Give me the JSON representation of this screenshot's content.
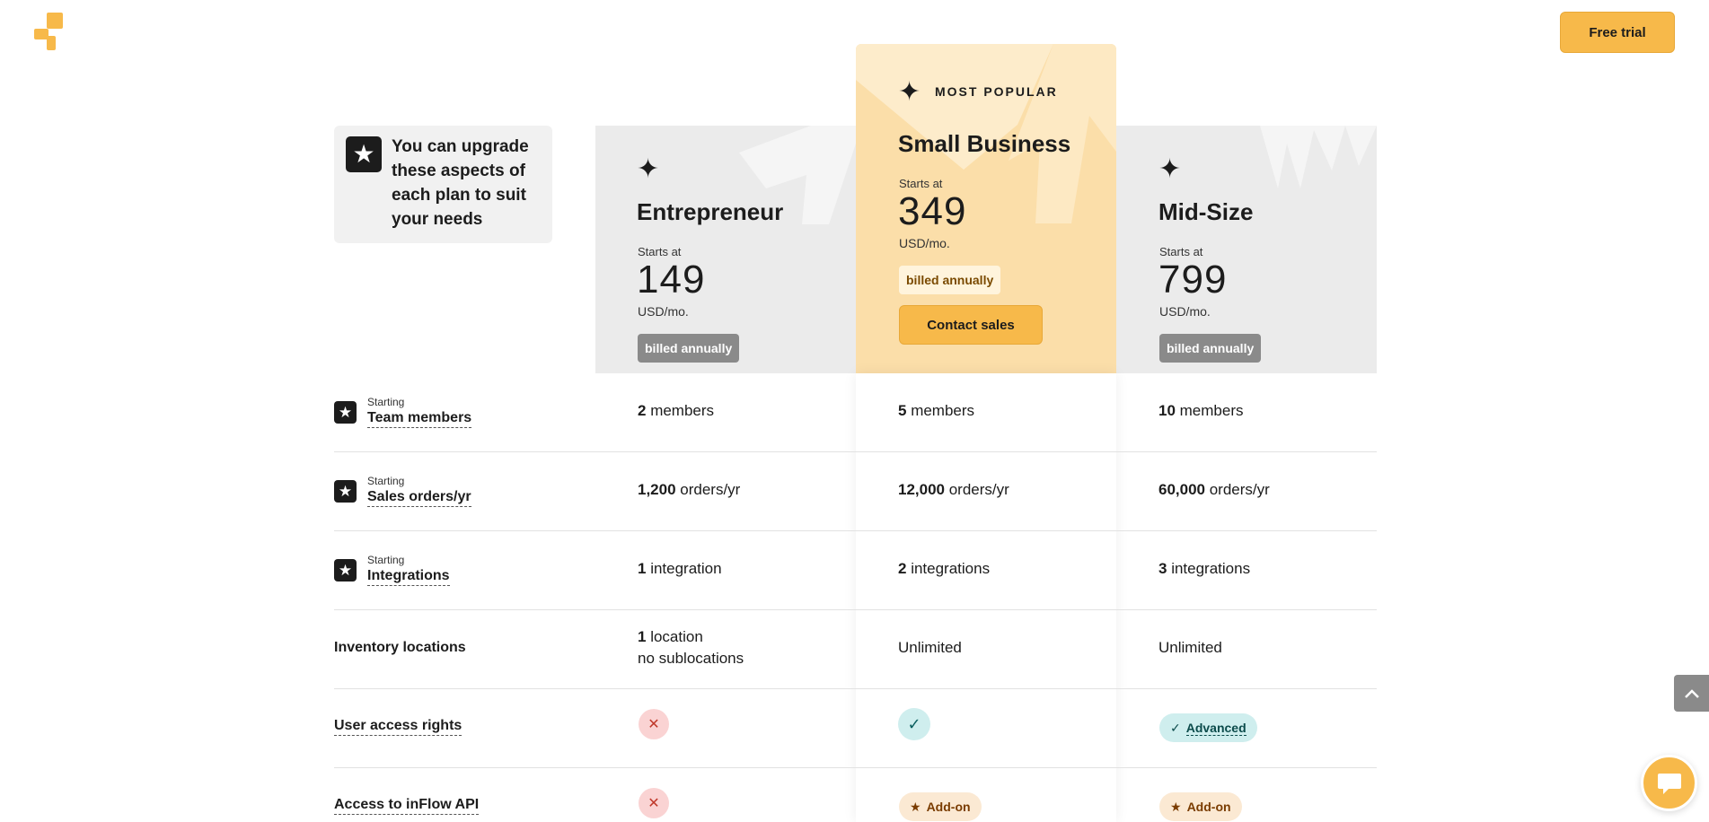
{
  "header": {
    "free_trial_label": "Free trial"
  },
  "upgrade_box": {
    "text": "You can upgrade these aspects of each plan to suit your needs"
  },
  "plans": [
    {
      "name": "Entrepreneur",
      "starts_at": "Starts at",
      "price": "149",
      "unit": "USD/mo.",
      "billing": "billed annually"
    },
    {
      "name": "Small Business",
      "badge": "MOST POPULAR",
      "starts_at": "Starts at",
      "price": "349",
      "unit": "USD/mo.",
      "billing": "billed annually",
      "cta": "Contact sales"
    },
    {
      "name": "Mid-Size",
      "starts_at": "Starts at",
      "price": "799",
      "unit": "USD/mo.",
      "billing": "billed annually"
    }
  ],
  "rows": {
    "team": {
      "prefix": "Starting",
      "label": "Team members",
      "values": [
        [
          "2",
          " members"
        ],
        [
          "5",
          " members"
        ],
        [
          "10",
          " members"
        ]
      ]
    },
    "orders": {
      "prefix": "Starting",
      "label": "Sales orders/yr",
      "values": [
        [
          "1,200",
          " orders/yr"
        ],
        [
          "12,000",
          " orders/yr"
        ],
        [
          "60,000",
          " orders/yr"
        ]
      ]
    },
    "integrations": {
      "prefix": "Starting",
      "label": "Integrations",
      "values": [
        [
          "1",
          " integration"
        ],
        [
          "2",
          " integrations"
        ],
        [
          "3",
          " integrations"
        ]
      ]
    },
    "locations": {
      "label": "Inventory locations",
      "ent_bold": "1",
      "ent_rest": " location",
      "ent_line2": "no sublocations",
      "sb": "Unlimited",
      "mid": "Unlimited"
    },
    "access": {
      "label": "User access rights",
      "mid_pill": "Advanced"
    },
    "api": {
      "label": "Access to inFlow API",
      "sb_pill": "Add-on",
      "mid_pill": "Add-on"
    }
  },
  "colors": {
    "accent": "#f7b94a",
    "highlight_column": "#fbdea9",
    "plan_bg": "#ebebeb"
  },
  "icons": {
    "logo": "inflow-logo",
    "plan": "sparkle-icon",
    "row": "star-icon",
    "no": "x-icon",
    "yes": "check-icon",
    "addon": "star-icon",
    "scroll": "chevron-up-icon",
    "chat": "chat-bubble-icon"
  }
}
